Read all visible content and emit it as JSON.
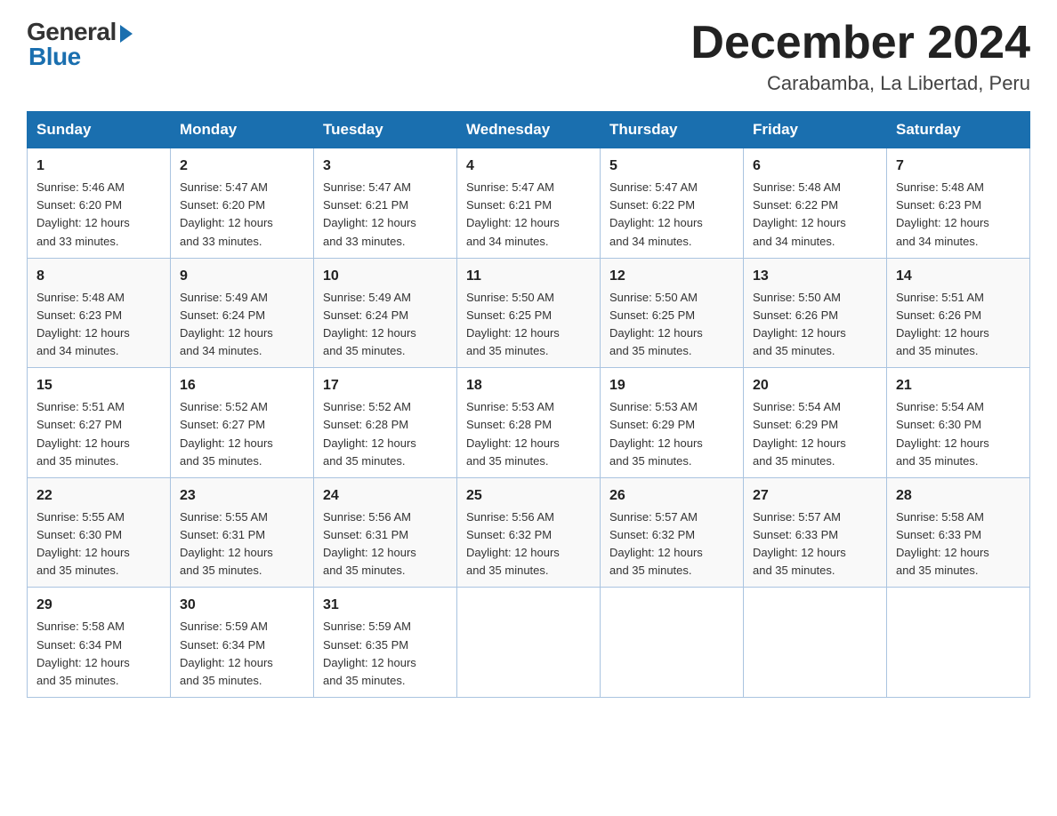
{
  "header": {
    "logo_general": "General",
    "logo_blue": "Blue",
    "month_title": "December 2024",
    "location": "Carabamba, La Libertad, Peru"
  },
  "weekdays": [
    "Sunday",
    "Monday",
    "Tuesday",
    "Wednesday",
    "Thursday",
    "Friday",
    "Saturday"
  ],
  "weeks": [
    [
      {
        "day": "1",
        "sunrise": "5:46 AM",
        "sunset": "6:20 PM",
        "daylight": "12 hours and 33 minutes."
      },
      {
        "day": "2",
        "sunrise": "5:47 AM",
        "sunset": "6:20 PM",
        "daylight": "12 hours and 33 minutes."
      },
      {
        "day": "3",
        "sunrise": "5:47 AM",
        "sunset": "6:21 PM",
        "daylight": "12 hours and 33 minutes."
      },
      {
        "day": "4",
        "sunrise": "5:47 AM",
        "sunset": "6:21 PM",
        "daylight": "12 hours and 34 minutes."
      },
      {
        "day": "5",
        "sunrise": "5:47 AM",
        "sunset": "6:22 PM",
        "daylight": "12 hours and 34 minutes."
      },
      {
        "day": "6",
        "sunrise": "5:48 AM",
        "sunset": "6:22 PM",
        "daylight": "12 hours and 34 minutes."
      },
      {
        "day": "7",
        "sunrise": "5:48 AM",
        "sunset": "6:23 PM",
        "daylight": "12 hours and 34 minutes."
      }
    ],
    [
      {
        "day": "8",
        "sunrise": "5:48 AM",
        "sunset": "6:23 PM",
        "daylight": "12 hours and 34 minutes."
      },
      {
        "day": "9",
        "sunrise": "5:49 AM",
        "sunset": "6:24 PM",
        "daylight": "12 hours and 34 minutes."
      },
      {
        "day": "10",
        "sunrise": "5:49 AM",
        "sunset": "6:24 PM",
        "daylight": "12 hours and 35 minutes."
      },
      {
        "day": "11",
        "sunrise": "5:50 AM",
        "sunset": "6:25 PM",
        "daylight": "12 hours and 35 minutes."
      },
      {
        "day": "12",
        "sunrise": "5:50 AM",
        "sunset": "6:25 PM",
        "daylight": "12 hours and 35 minutes."
      },
      {
        "day": "13",
        "sunrise": "5:50 AM",
        "sunset": "6:26 PM",
        "daylight": "12 hours and 35 minutes."
      },
      {
        "day": "14",
        "sunrise": "5:51 AM",
        "sunset": "6:26 PM",
        "daylight": "12 hours and 35 minutes."
      }
    ],
    [
      {
        "day": "15",
        "sunrise": "5:51 AM",
        "sunset": "6:27 PM",
        "daylight": "12 hours and 35 minutes."
      },
      {
        "day": "16",
        "sunrise": "5:52 AM",
        "sunset": "6:27 PM",
        "daylight": "12 hours and 35 minutes."
      },
      {
        "day": "17",
        "sunrise": "5:52 AM",
        "sunset": "6:28 PM",
        "daylight": "12 hours and 35 minutes."
      },
      {
        "day": "18",
        "sunrise": "5:53 AM",
        "sunset": "6:28 PM",
        "daylight": "12 hours and 35 minutes."
      },
      {
        "day": "19",
        "sunrise": "5:53 AM",
        "sunset": "6:29 PM",
        "daylight": "12 hours and 35 minutes."
      },
      {
        "day": "20",
        "sunrise": "5:54 AM",
        "sunset": "6:29 PM",
        "daylight": "12 hours and 35 minutes."
      },
      {
        "day": "21",
        "sunrise": "5:54 AM",
        "sunset": "6:30 PM",
        "daylight": "12 hours and 35 minutes."
      }
    ],
    [
      {
        "day": "22",
        "sunrise": "5:55 AM",
        "sunset": "6:30 PM",
        "daylight": "12 hours and 35 minutes."
      },
      {
        "day": "23",
        "sunrise": "5:55 AM",
        "sunset": "6:31 PM",
        "daylight": "12 hours and 35 minutes."
      },
      {
        "day": "24",
        "sunrise": "5:56 AM",
        "sunset": "6:31 PM",
        "daylight": "12 hours and 35 minutes."
      },
      {
        "day": "25",
        "sunrise": "5:56 AM",
        "sunset": "6:32 PM",
        "daylight": "12 hours and 35 minutes."
      },
      {
        "day": "26",
        "sunrise": "5:57 AM",
        "sunset": "6:32 PM",
        "daylight": "12 hours and 35 minutes."
      },
      {
        "day": "27",
        "sunrise": "5:57 AM",
        "sunset": "6:33 PM",
        "daylight": "12 hours and 35 minutes."
      },
      {
        "day": "28",
        "sunrise": "5:58 AM",
        "sunset": "6:33 PM",
        "daylight": "12 hours and 35 minutes."
      }
    ],
    [
      {
        "day": "29",
        "sunrise": "5:58 AM",
        "sunset": "6:34 PM",
        "daylight": "12 hours and 35 minutes."
      },
      {
        "day": "30",
        "sunrise": "5:59 AM",
        "sunset": "6:34 PM",
        "daylight": "12 hours and 35 minutes."
      },
      {
        "day": "31",
        "sunrise": "5:59 AM",
        "sunset": "6:35 PM",
        "daylight": "12 hours and 35 minutes."
      },
      null,
      null,
      null,
      null
    ]
  ],
  "labels": {
    "sunrise": "Sunrise:",
    "sunset": "Sunset:",
    "daylight": "Daylight:"
  },
  "colors": {
    "header_bg": "#1a6faf",
    "border": "#aac4e0"
  }
}
